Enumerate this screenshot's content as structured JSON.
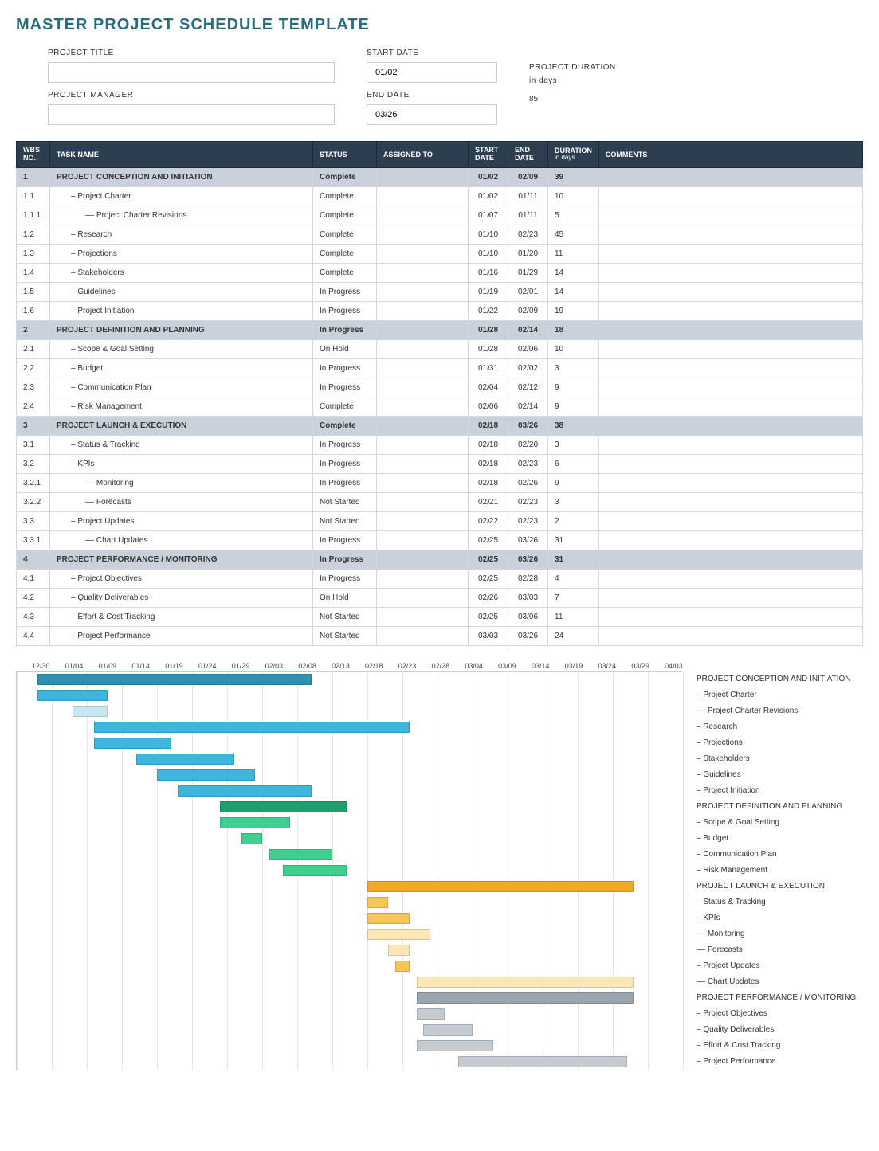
{
  "title": "MASTER PROJECT SCHEDULE TEMPLATE",
  "meta": {
    "project_title_label": "PROJECT TITLE",
    "project_title_value": "",
    "project_manager_label": "PROJECT MANAGER",
    "project_manager_value": "",
    "start_date_label": "START DATE",
    "start_date_value": "01/02",
    "end_date_label": "END DATE",
    "end_date_value": "03/26",
    "project_duration_label": "PROJECT DURATION",
    "project_duration_unit": "in days",
    "project_duration_value": "85"
  },
  "columns": {
    "wbs": "WBS NO.",
    "task": "TASK NAME",
    "status": "STATUS",
    "assigned": "ASSIGNED TO",
    "start": "START DATE",
    "end": "END DATE",
    "duration": "DURATION",
    "duration_sub": "in days",
    "comments": "COMMENTS"
  },
  "rows": [
    {
      "wbs": "1",
      "task": "PROJECT CONCEPTION AND INITIATION",
      "status": "Complete",
      "assigned": "",
      "start": "01/02",
      "end": "02/09",
      "dur": "39",
      "comments": "",
      "phase": true
    },
    {
      "wbs": "1.1",
      "task": "– Project Charter",
      "status": "Complete",
      "assigned": "",
      "start": "01/02",
      "end": "01/11",
      "dur": "10",
      "comments": "",
      "indent": 1
    },
    {
      "wbs": "1.1.1",
      "task": "–– Project Charter Revisions",
      "status": "Complete",
      "assigned": "",
      "start": "01/07",
      "end": "01/11",
      "dur": "5",
      "comments": "",
      "indent": 2
    },
    {
      "wbs": "1.2",
      "task": "– Research",
      "status": "Complete",
      "assigned": "",
      "start": "01/10",
      "end": "02/23",
      "dur": "45",
      "comments": "",
      "indent": 1
    },
    {
      "wbs": "1.3",
      "task": "– Projections",
      "status": "Complete",
      "assigned": "",
      "start": "01/10",
      "end": "01/20",
      "dur": "11",
      "comments": "",
      "indent": 1
    },
    {
      "wbs": "1.4",
      "task": "– Stakeholders",
      "status": "Complete",
      "assigned": "",
      "start": "01/16",
      "end": "01/29",
      "dur": "14",
      "comments": "",
      "indent": 1
    },
    {
      "wbs": "1.5",
      "task": "– Guidelines",
      "status": "In Progress",
      "assigned": "",
      "start": "01/19",
      "end": "02/01",
      "dur": "14",
      "comments": "",
      "indent": 1
    },
    {
      "wbs": "1.6",
      "task": "– Project Initiation",
      "status": "In Progress",
      "assigned": "",
      "start": "01/22",
      "end": "02/09",
      "dur": "19",
      "comments": "",
      "indent": 1
    },
    {
      "wbs": "2",
      "task": "PROJECT DEFINITION AND PLANNING",
      "status": "In Progress",
      "assigned": "",
      "start": "01/28",
      "end": "02/14",
      "dur": "18",
      "comments": "",
      "phase": true
    },
    {
      "wbs": "2.1",
      "task": "– Scope & Goal Setting",
      "status": "On Hold",
      "assigned": "",
      "start": "01/28",
      "end": "02/06",
      "dur": "10",
      "comments": "",
      "indent": 1
    },
    {
      "wbs": "2.2",
      "task": "– Budget",
      "status": "In Progress",
      "assigned": "",
      "start": "01/31",
      "end": "02/02",
      "dur": "3",
      "comments": "",
      "indent": 1
    },
    {
      "wbs": "2.3",
      "task": "– Communication Plan",
      "status": "In Progress",
      "assigned": "",
      "start": "02/04",
      "end": "02/12",
      "dur": "9",
      "comments": "",
      "indent": 1
    },
    {
      "wbs": "2.4",
      "task": "– Risk Management",
      "status": "Complete",
      "assigned": "",
      "start": "02/06",
      "end": "02/14",
      "dur": "9",
      "comments": "",
      "indent": 1
    },
    {
      "wbs": "3",
      "task": "PROJECT LAUNCH & EXECUTION",
      "status": "Complete",
      "assigned": "",
      "start": "02/18",
      "end": "03/26",
      "dur": "38",
      "comments": "",
      "phase": true
    },
    {
      "wbs": "3.1",
      "task": "– Status & Tracking",
      "status": "In Progress",
      "assigned": "",
      "start": "02/18",
      "end": "02/20",
      "dur": "3",
      "comments": "",
      "indent": 1
    },
    {
      "wbs": "3.2",
      "task": "– KPIs",
      "status": "In Progress",
      "assigned": "",
      "start": "02/18",
      "end": "02/23",
      "dur": "6",
      "comments": "",
      "indent": 1
    },
    {
      "wbs": "3.2.1",
      "task": "–– Monitoring",
      "status": "In Progress",
      "assigned": "",
      "start": "02/18",
      "end": "02/26",
      "dur": "9",
      "comments": "",
      "indent": 2
    },
    {
      "wbs": "3.2.2",
      "task": "–– Forecasts",
      "status": "Not Started",
      "assigned": "",
      "start": "02/21",
      "end": "02/23",
      "dur": "3",
      "comments": "",
      "indent": 2
    },
    {
      "wbs": "3.3",
      "task": "– Project Updates",
      "status": "Not Started",
      "assigned": "",
      "start": "02/22",
      "end": "02/23",
      "dur": "2",
      "comments": "",
      "indent": 1
    },
    {
      "wbs": "3.3.1",
      "task": "–– Chart Updates",
      "status": "In Progress",
      "assigned": "",
      "start": "02/25",
      "end": "03/26",
      "dur": "31",
      "comments": "",
      "indent": 2
    },
    {
      "wbs": "4",
      "task": "PROJECT PERFORMANCE / MONITORING",
      "status": "In Progress",
      "assigned": "",
      "start": "02/25",
      "end": "03/26",
      "dur": "31",
      "comments": "",
      "phase": true
    },
    {
      "wbs": "4.1",
      "task": "– Project Objectives",
      "status": "In Progress",
      "assigned": "",
      "start": "02/25",
      "end": "02/28",
      "dur": "4",
      "comments": "",
      "indent": 1
    },
    {
      "wbs": "4.2",
      "task": "– Quality Deliverables",
      "status": "On Hold",
      "assigned": "",
      "start": "02/26",
      "end": "03/03",
      "dur": "7",
      "comments": "",
      "indent": 1
    },
    {
      "wbs": "4.3",
      "task": "– Effort & Cost Tracking",
      "status": "Not Started",
      "assigned": "",
      "start": "02/25",
      "end": "03/06",
      "dur": "11",
      "comments": "",
      "indent": 1
    },
    {
      "wbs": "4.4",
      "task": "– Project Performance",
      "status": "Not Started",
      "assigned": "",
      "start": "03/03",
      "end": "03/26",
      "dur": "24",
      "comments": "",
      "indent": 1
    }
  ],
  "chart_data": {
    "type": "bar",
    "title": "",
    "xlabel": "",
    "ylabel": "",
    "x_axis_dates": [
      "12/30",
      "01/04",
      "01/09",
      "01/14",
      "01/19",
      "01/24",
      "01/29",
      "02/03",
      "02/08",
      "02/13",
      "02/18",
      "02/23",
      "02/28",
      "03/04",
      "03/09",
      "03/14",
      "03/19",
      "03/24",
      "03/29",
      "04/03"
    ],
    "range_start": "12/30",
    "range_end": "04/03",
    "total_days": 95,
    "color_map": {
      "phase1": "#2f8fb5",
      "phase1_sub": "#3fb5dd",
      "phase1_subsub": "#c9e7f3",
      "phase2": "#1f9f6d",
      "phase2_sub": "#3fcf8f",
      "phase3": "#f5a825",
      "phase3_sub": "#f6c556",
      "phase3_subsub": "#fbe7b6",
      "phase4": "#9aa6ae",
      "phase4_sub": "#c4ccd1"
    },
    "series": [
      {
        "name": "PROJECT CONCEPTION AND INITIATION",
        "start_offset": 3,
        "duration": 39,
        "color": "phase1"
      },
      {
        "name": "– Project Charter",
        "start_offset": 3,
        "duration": 10,
        "color": "phase1_sub"
      },
      {
        "name": "–– Project Charter Revisions",
        "start_offset": 8,
        "duration": 5,
        "color": "phase1_subsub"
      },
      {
        "name": "– Research",
        "start_offset": 11,
        "duration": 45,
        "color": "phase1_sub"
      },
      {
        "name": "– Projections",
        "start_offset": 11,
        "duration": 11,
        "color": "phase1_sub"
      },
      {
        "name": "– Stakeholders",
        "start_offset": 17,
        "duration": 14,
        "color": "phase1_sub"
      },
      {
        "name": "– Guidelines",
        "start_offset": 20,
        "duration": 14,
        "color": "phase1_sub"
      },
      {
        "name": "– Project Initiation",
        "start_offset": 23,
        "duration": 19,
        "color": "phase1_sub"
      },
      {
        "name": "PROJECT DEFINITION AND PLANNING",
        "start_offset": 29,
        "duration": 18,
        "color": "phase2"
      },
      {
        "name": "– Scope & Goal Setting",
        "start_offset": 29,
        "duration": 10,
        "color": "phase2_sub"
      },
      {
        "name": "– Budget",
        "start_offset": 32,
        "duration": 3,
        "color": "phase2_sub"
      },
      {
        "name": "– Communication Plan",
        "start_offset": 36,
        "duration": 9,
        "color": "phase2_sub"
      },
      {
        "name": "– Risk Management",
        "start_offset": 38,
        "duration": 9,
        "color": "phase2_sub"
      },
      {
        "name": "PROJECT LAUNCH & EXECUTION",
        "start_offset": 50,
        "duration": 38,
        "color": "phase3"
      },
      {
        "name": "– Status & Tracking",
        "start_offset": 50,
        "duration": 3,
        "color": "phase3_sub"
      },
      {
        "name": "– KPIs",
        "start_offset": 50,
        "duration": 6,
        "color": "phase3_sub"
      },
      {
        "name": "–– Monitoring",
        "start_offset": 50,
        "duration": 9,
        "color": "phase3_subsub"
      },
      {
        "name": "–– Forecasts",
        "start_offset": 53,
        "duration": 3,
        "color": "phase3_subsub"
      },
      {
        "name": "– Project Updates",
        "start_offset": 54,
        "duration": 2,
        "color": "phase3_sub"
      },
      {
        "name": "–– Chart Updates",
        "start_offset": 57,
        "duration": 31,
        "color": "phase3_subsub"
      },
      {
        "name": "PROJECT PERFORMANCE / MONITORING",
        "start_offset": 57,
        "duration": 31,
        "color": "phase4"
      },
      {
        "name": "– Project Objectives",
        "start_offset": 57,
        "duration": 4,
        "color": "phase4_sub"
      },
      {
        "name": "– Quality Deliverables",
        "start_offset": 58,
        "duration": 7,
        "color": "phase4_sub"
      },
      {
        "name": "– Effort & Cost Tracking",
        "start_offset": 57,
        "duration": 11,
        "color": "phase4_sub"
      },
      {
        "name": "– Project Performance",
        "start_offset": 63,
        "duration": 24,
        "color": "phase4_sub"
      }
    ]
  }
}
